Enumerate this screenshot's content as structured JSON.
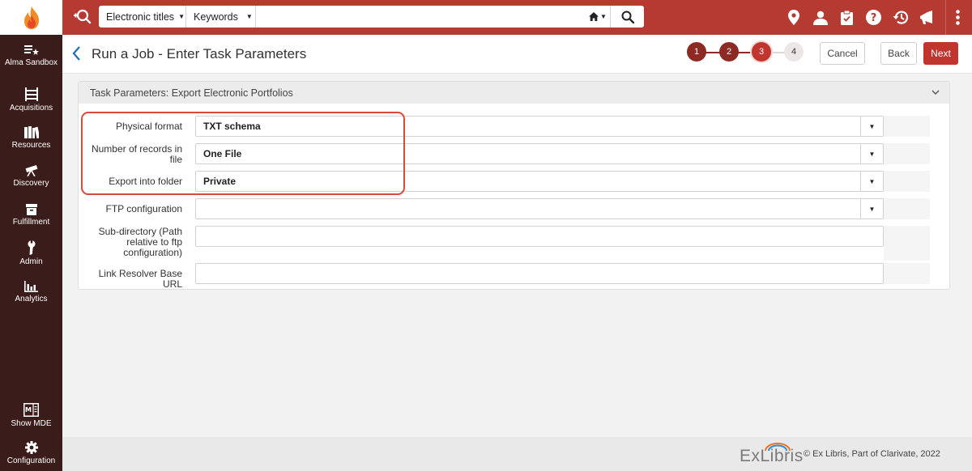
{
  "search": {
    "scope_label": "Electronic titles",
    "field_label": "Keywords",
    "query": "",
    "placeholder": ""
  },
  "sidebar": {
    "items": [
      {
        "label": "Alma Sandbox",
        "icon": "sandbox-icon"
      },
      {
        "label": "Acquisitions",
        "icon": "acquisitions-icon"
      },
      {
        "label": "Resources",
        "icon": "resources-icon"
      },
      {
        "label": "Discovery",
        "icon": "telescope-icon"
      },
      {
        "label": "Fulfillment",
        "icon": "fulfillment-icon"
      },
      {
        "label": "Admin",
        "icon": "wrench-icon"
      },
      {
        "label": "Analytics",
        "icon": "analytics-icon"
      },
      {
        "label": "Show MDE",
        "icon": "mde-icon"
      },
      {
        "label": "Configuration",
        "icon": "gear-icon"
      }
    ]
  },
  "header": {
    "title": "Run a Job - Enter Task Parameters",
    "steps": [
      "1",
      "2",
      "3",
      "4"
    ],
    "current_step": 3,
    "cancel_label": "Cancel",
    "back_label": "Back",
    "next_label": "Next"
  },
  "panel": {
    "title": "Task Parameters: Export Electronic Portfolios",
    "rows": [
      {
        "label": "Physical format",
        "value": "TXT schema",
        "type": "select"
      },
      {
        "label": "Number of records in file",
        "value": "One File",
        "type": "select"
      },
      {
        "label": "Export into folder",
        "value": "Private",
        "type": "select"
      },
      {
        "label": "FTP configuration",
        "value": "",
        "type": "select"
      },
      {
        "label": "Sub-directory (Path relative to ftp configuration)",
        "value": "",
        "type": "text"
      },
      {
        "label": "Link Resolver Base URL",
        "value": "",
        "type": "text"
      }
    ]
  },
  "footer": {
    "brand": "ExLibris",
    "copyright": "© Ex Libris, Part of Clarivate,   2022"
  },
  "colors": {
    "brand": "#b53a31",
    "sidebar": "#3a1c1b",
    "next_button": "#c1352f",
    "step_done": "#8e2a26",
    "step_current": "#c1352f",
    "highlight": "#d94a3a"
  }
}
